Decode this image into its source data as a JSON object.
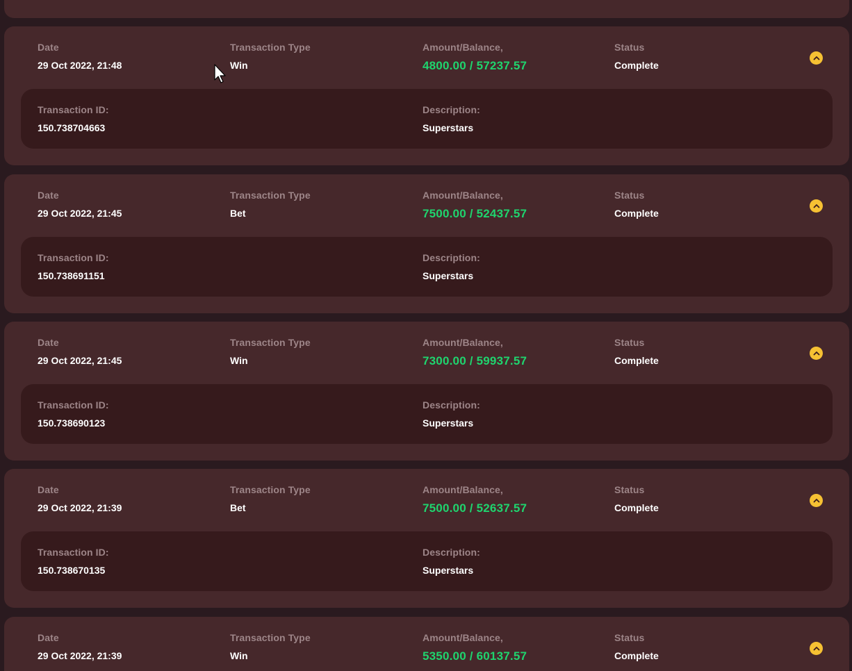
{
  "labels": {
    "date": "Date",
    "type": "Transaction Type",
    "amount": "Amount/Balance,",
    "status": "Status",
    "transaction_id": "Transaction ID:",
    "description": "Description:"
  },
  "colors": {
    "card": "#46282b",
    "details": "#361a1c",
    "amount": "#1fd46e",
    "toggle": "#f6c133"
  },
  "icons": {
    "toggle": "chevron-up-icon",
    "cursor": "mouse-cursor-icon"
  },
  "transactions": [
    {
      "date": "29 Oct 2022, 21:48",
      "type": "Win",
      "amount": "4800.00 / 57237.57",
      "status": "Complete",
      "transaction_id": "150.738704663",
      "description": "Superstars"
    },
    {
      "date": "29 Oct 2022, 21:45",
      "type": "Bet",
      "amount": "7500.00 / 52437.57",
      "status": "Complete",
      "transaction_id": "150.738691151",
      "description": "Superstars"
    },
    {
      "date": "29 Oct 2022, 21:45",
      "type": "Win",
      "amount": "7300.00 / 59937.57",
      "status": "Complete",
      "transaction_id": "150.738690123",
      "description": "Superstars"
    },
    {
      "date": "29 Oct 2022, 21:39",
      "type": "Bet",
      "amount": "7500.00 / 52637.57",
      "status": "Complete",
      "transaction_id": "150.738670135",
      "description": "Superstars"
    },
    {
      "date": "29 Oct 2022, 21:39",
      "type": "Win",
      "amount": "5350.00 / 60137.57",
      "status": "Complete"
    }
  ]
}
